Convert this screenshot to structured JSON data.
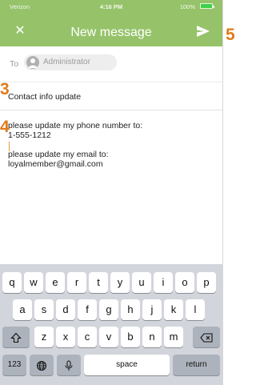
{
  "status_bar": {
    "carrier": "Verizon",
    "time": "4:16 PM",
    "battery": "100%"
  },
  "header": {
    "title": "New message",
    "close_icon": "close-icon",
    "send_icon": "send-icon"
  },
  "to_field": {
    "label": "To",
    "recipient": "Administrator"
  },
  "subject": "Contact info update",
  "message_lines": [
    "please update my phone number to:",
    "1-555-1212",
    "",
    "please update my email to:",
    "loyalmember@gmail.com"
  ],
  "callouts": [
    "3",
    "4",
    "5"
  ],
  "keyboard": {
    "row1": [
      "q",
      "w",
      "e",
      "r",
      "t",
      "y",
      "u",
      "i",
      "o",
      "p"
    ],
    "row2": [
      "a",
      "s",
      "d",
      "f",
      "g",
      "h",
      "j",
      "k",
      "l"
    ],
    "row3": [
      "z",
      "x",
      "c",
      "v",
      "b",
      "n",
      "m"
    ],
    "numbers_key": "123",
    "space_key": "space",
    "return_key": "return",
    "shift_icon": "shift-icon",
    "delete_icon": "backspace-icon",
    "globe_icon": "globe-icon",
    "mic_icon": "microphone-icon"
  },
  "colors": {
    "header": "#96c36a",
    "callout": "#e07b1c",
    "keyboard_bg": "#d2d5db"
  }
}
